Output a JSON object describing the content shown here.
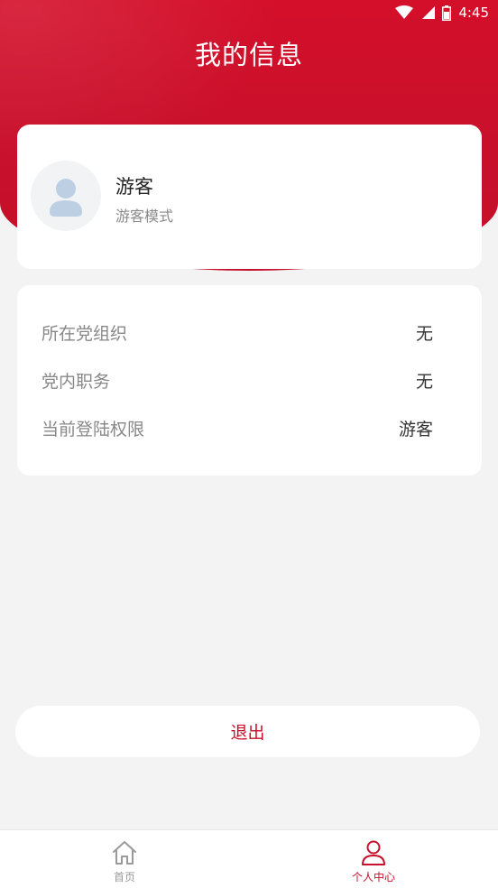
{
  "status_bar": {
    "time": "4:45"
  },
  "header": {
    "title": "我的信息"
  },
  "profile": {
    "name": "游客",
    "mode": "游客模式"
  },
  "info": {
    "rows": [
      {
        "label": "所在党组织",
        "value": "无"
      },
      {
        "label": "党内职务",
        "value": "无"
      },
      {
        "label": "当前登陆权限",
        "value": "游客"
      }
    ]
  },
  "logout_label": "退出",
  "tabs": [
    {
      "label": "首页",
      "icon": "home-icon",
      "active": false
    },
    {
      "label": "个人中心",
      "icon": "user-icon",
      "active": true
    }
  ],
  "colors": {
    "brand": "#c8102b",
    "background": "#f3f3f4",
    "inactive": "#9a9a9a"
  }
}
